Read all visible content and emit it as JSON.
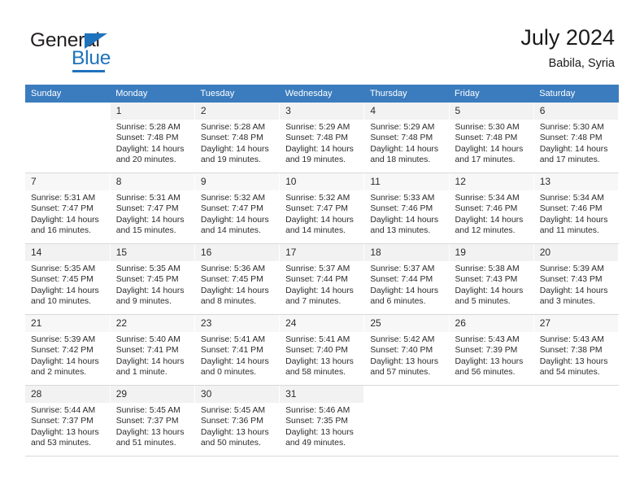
{
  "brand": {
    "name_top": "General",
    "name_bottom": "Blue",
    "accent_color": "#1f73bd",
    "triangle_icon": "triangle-icon"
  },
  "header": {
    "title": "July 2024",
    "subtitle": "Babila, Syria"
  },
  "calendar": {
    "header_bg": "#3b7cbe",
    "header_text_color": "#ffffff",
    "weekday_headers": [
      "Sunday",
      "Monday",
      "Tuesday",
      "Wednesday",
      "Thursday",
      "Friday",
      "Saturday"
    ],
    "weeks": [
      [
        {
          "day": "",
          "sunrise": "",
          "sunset": "",
          "daylight_line1": "",
          "daylight_line2": ""
        },
        {
          "day": "1",
          "sunrise": "Sunrise: 5:28 AM",
          "sunset": "Sunset: 7:48 PM",
          "daylight_line1": "Daylight: 14 hours",
          "daylight_line2": "and 20 minutes."
        },
        {
          "day": "2",
          "sunrise": "Sunrise: 5:28 AM",
          "sunset": "Sunset: 7:48 PM",
          "daylight_line1": "Daylight: 14 hours",
          "daylight_line2": "and 19 minutes."
        },
        {
          "day": "3",
          "sunrise": "Sunrise: 5:29 AM",
          "sunset": "Sunset: 7:48 PM",
          "daylight_line1": "Daylight: 14 hours",
          "daylight_line2": "and 19 minutes."
        },
        {
          "day": "4",
          "sunrise": "Sunrise: 5:29 AM",
          "sunset": "Sunset: 7:48 PM",
          "daylight_line1": "Daylight: 14 hours",
          "daylight_line2": "and 18 minutes."
        },
        {
          "day": "5",
          "sunrise": "Sunrise: 5:30 AM",
          "sunset": "Sunset: 7:48 PM",
          "daylight_line1": "Daylight: 14 hours",
          "daylight_line2": "and 17 minutes."
        },
        {
          "day": "6",
          "sunrise": "Sunrise: 5:30 AM",
          "sunset": "Sunset: 7:48 PM",
          "daylight_line1": "Daylight: 14 hours",
          "daylight_line2": "and 17 minutes."
        }
      ],
      [
        {
          "day": "7",
          "sunrise": "Sunrise: 5:31 AM",
          "sunset": "Sunset: 7:47 PM",
          "daylight_line1": "Daylight: 14 hours",
          "daylight_line2": "and 16 minutes."
        },
        {
          "day": "8",
          "sunrise": "Sunrise: 5:31 AM",
          "sunset": "Sunset: 7:47 PM",
          "daylight_line1": "Daylight: 14 hours",
          "daylight_line2": "and 15 minutes."
        },
        {
          "day": "9",
          "sunrise": "Sunrise: 5:32 AM",
          "sunset": "Sunset: 7:47 PM",
          "daylight_line1": "Daylight: 14 hours",
          "daylight_line2": "and 14 minutes."
        },
        {
          "day": "10",
          "sunrise": "Sunrise: 5:32 AM",
          "sunset": "Sunset: 7:47 PM",
          "daylight_line1": "Daylight: 14 hours",
          "daylight_line2": "and 14 minutes."
        },
        {
          "day": "11",
          "sunrise": "Sunrise: 5:33 AM",
          "sunset": "Sunset: 7:46 PM",
          "daylight_line1": "Daylight: 14 hours",
          "daylight_line2": "and 13 minutes."
        },
        {
          "day": "12",
          "sunrise": "Sunrise: 5:34 AM",
          "sunset": "Sunset: 7:46 PM",
          "daylight_line1": "Daylight: 14 hours",
          "daylight_line2": "and 12 minutes."
        },
        {
          "day": "13",
          "sunrise": "Sunrise: 5:34 AM",
          "sunset": "Sunset: 7:46 PM",
          "daylight_line1": "Daylight: 14 hours",
          "daylight_line2": "and 11 minutes."
        }
      ],
      [
        {
          "day": "14",
          "sunrise": "Sunrise: 5:35 AM",
          "sunset": "Sunset: 7:45 PM",
          "daylight_line1": "Daylight: 14 hours",
          "daylight_line2": "and 10 minutes."
        },
        {
          "day": "15",
          "sunrise": "Sunrise: 5:35 AM",
          "sunset": "Sunset: 7:45 PM",
          "daylight_line1": "Daylight: 14 hours",
          "daylight_line2": "and 9 minutes."
        },
        {
          "day": "16",
          "sunrise": "Sunrise: 5:36 AM",
          "sunset": "Sunset: 7:45 PM",
          "daylight_line1": "Daylight: 14 hours",
          "daylight_line2": "and 8 minutes."
        },
        {
          "day": "17",
          "sunrise": "Sunrise: 5:37 AM",
          "sunset": "Sunset: 7:44 PM",
          "daylight_line1": "Daylight: 14 hours",
          "daylight_line2": "and 7 minutes."
        },
        {
          "day": "18",
          "sunrise": "Sunrise: 5:37 AM",
          "sunset": "Sunset: 7:44 PM",
          "daylight_line1": "Daylight: 14 hours",
          "daylight_line2": "and 6 minutes."
        },
        {
          "day": "19",
          "sunrise": "Sunrise: 5:38 AM",
          "sunset": "Sunset: 7:43 PM",
          "daylight_line1": "Daylight: 14 hours",
          "daylight_line2": "and 5 minutes."
        },
        {
          "day": "20",
          "sunrise": "Sunrise: 5:39 AM",
          "sunset": "Sunset: 7:43 PM",
          "daylight_line1": "Daylight: 14 hours",
          "daylight_line2": "and 3 minutes."
        }
      ],
      [
        {
          "day": "21",
          "sunrise": "Sunrise: 5:39 AM",
          "sunset": "Sunset: 7:42 PM",
          "daylight_line1": "Daylight: 14 hours",
          "daylight_line2": "and 2 minutes."
        },
        {
          "day": "22",
          "sunrise": "Sunrise: 5:40 AM",
          "sunset": "Sunset: 7:41 PM",
          "daylight_line1": "Daylight: 14 hours",
          "daylight_line2": "and 1 minute."
        },
        {
          "day": "23",
          "sunrise": "Sunrise: 5:41 AM",
          "sunset": "Sunset: 7:41 PM",
          "daylight_line1": "Daylight: 14 hours",
          "daylight_line2": "and 0 minutes."
        },
        {
          "day": "24",
          "sunrise": "Sunrise: 5:41 AM",
          "sunset": "Sunset: 7:40 PM",
          "daylight_line1": "Daylight: 13 hours",
          "daylight_line2": "and 58 minutes."
        },
        {
          "day": "25",
          "sunrise": "Sunrise: 5:42 AM",
          "sunset": "Sunset: 7:40 PM",
          "daylight_line1": "Daylight: 13 hours",
          "daylight_line2": "and 57 minutes."
        },
        {
          "day": "26",
          "sunrise": "Sunrise: 5:43 AM",
          "sunset": "Sunset: 7:39 PM",
          "daylight_line1": "Daylight: 13 hours",
          "daylight_line2": "and 56 minutes."
        },
        {
          "day": "27",
          "sunrise": "Sunrise: 5:43 AM",
          "sunset": "Sunset: 7:38 PM",
          "daylight_line1": "Daylight: 13 hours",
          "daylight_line2": "and 54 minutes."
        }
      ],
      [
        {
          "day": "28",
          "sunrise": "Sunrise: 5:44 AM",
          "sunset": "Sunset: 7:37 PM",
          "daylight_line1": "Daylight: 13 hours",
          "daylight_line2": "and 53 minutes."
        },
        {
          "day": "29",
          "sunrise": "Sunrise: 5:45 AM",
          "sunset": "Sunset: 7:37 PM",
          "daylight_line1": "Daylight: 13 hours",
          "daylight_line2": "and 51 minutes."
        },
        {
          "day": "30",
          "sunrise": "Sunrise: 5:45 AM",
          "sunset": "Sunset: 7:36 PM",
          "daylight_line1": "Daylight: 13 hours",
          "daylight_line2": "and 50 minutes."
        },
        {
          "day": "31",
          "sunrise": "Sunrise: 5:46 AM",
          "sunset": "Sunset: 7:35 PM",
          "daylight_line1": "Daylight: 13 hours",
          "daylight_line2": "and 49 minutes."
        },
        {
          "day": "",
          "sunrise": "",
          "sunset": "",
          "daylight_line1": "",
          "daylight_line2": ""
        },
        {
          "day": "",
          "sunrise": "",
          "sunset": "",
          "daylight_line1": "",
          "daylight_line2": ""
        },
        {
          "day": "",
          "sunrise": "",
          "sunset": "",
          "daylight_line1": "",
          "daylight_line2": ""
        }
      ]
    ]
  }
}
